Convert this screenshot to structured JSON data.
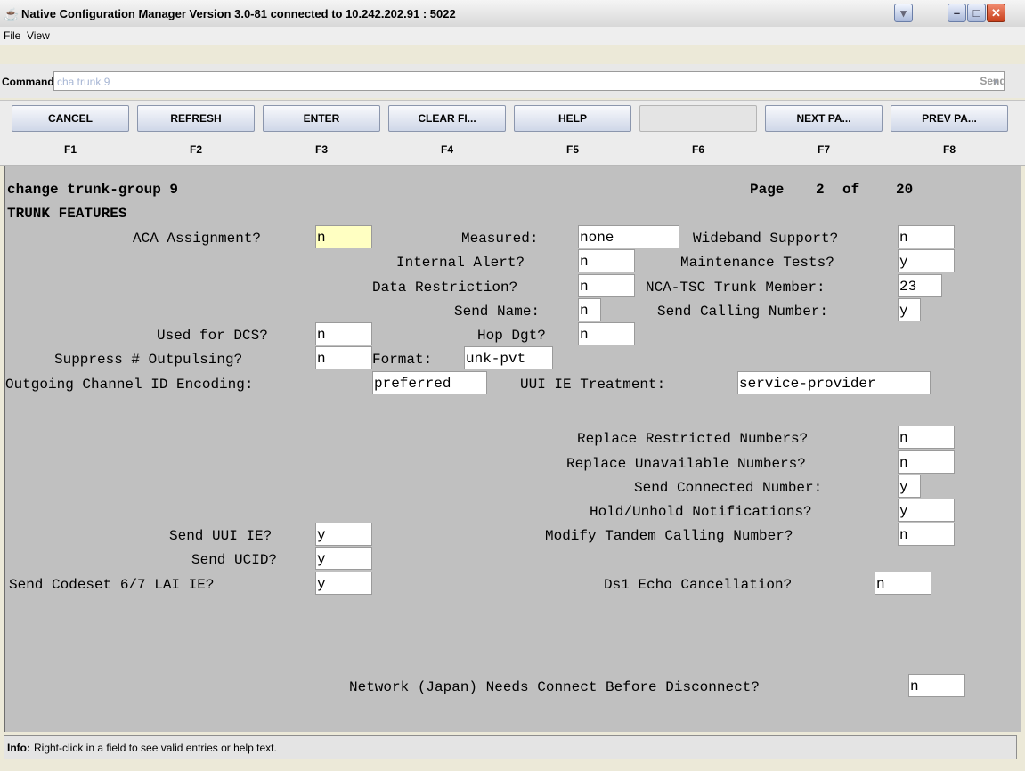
{
  "window": {
    "title": "Native Configuration Manager Version 3.0-81 connected to 10.242.202.91 : 5022",
    "controls": {
      "minimize": "–",
      "maximize": "□",
      "close": "✕",
      "dropdown": "▾"
    }
  },
  "menu": {
    "items": [
      "File",
      "View"
    ]
  },
  "command": {
    "label": "Command:",
    "value": "cha trunk 9",
    "send_label": "Send"
  },
  "function_keys": [
    {
      "label": "CANCEL",
      "key": "F1"
    },
    {
      "label": "REFRESH",
      "key": "F2"
    },
    {
      "label": "ENTER",
      "key": "F3"
    },
    {
      "label": "CLEAR FI...",
      "key": "F4"
    },
    {
      "label": "HELP",
      "key": "F5"
    },
    {
      "label": "",
      "key": "F6"
    },
    {
      "label": "NEXT PA...",
      "key": "F7"
    },
    {
      "label": "PREV PA...",
      "key": "F8"
    }
  ],
  "form": {
    "title": "change trunk-group 9",
    "page_label": "Page",
    "page_current": "2",
    "page_of": "of",
    "page_total": "20",
    "section": "TRUNK FEATURES",
    "fields": [
      {
        "label": "ACA Assignment?",
        "value": "n"
      },
      {
        "label": "Measured:",
        "value": "none"
      },
      {
        "label": "Wideband Support?",
        "value": "n"
      },
      {
        "label": "Internal Alert?",
        "value": "n"
      },
      {
        "label": "Maintenance Tests?",
        "value": "y"
      },
      {
        "label": "Data Restriction?",
        "value": "n"
      },
      {
        "label": "NCA-TSC Trunk Member:",
        "value": "23"
      },
      {
        "label": "Send Name:",
        "value": "n"
      },
      {
        "label": "Send Calling Number:",
        "value": "y"
      },
      {
        "label": "Used for DCS?",
        "value": "n"
      },
      {
        "label": "Hop Dgt?",
        "value": "n"
      },
      {
        "label": "Suppress # Outpulsing?",
        "value": "n"
      },
      {
        "label": "Format:",
        "value": "unk-pvt"
      },
      {
        "label": "Outgoing Channel ID Encoding:",
        "value": "preferred"
      },
      {
        "label": "UUI IE Treatment:",
        "value": "service-provider"
      },
      {
        "label": "Replace Restricted Numbers?",
        "value": "n"
      },
      {
        "label": "Replace Unavailable Numbers?",
        "value": "n"
      },
      {
        "label": "Send Connected Number:",
        "value": "y"
      },
      {
        "label": "Hold/Unhold Notifications?",
        "value": "y"
      },
      {
        "label": "Send UUI IE?",
        "value": "y"
      },
      {
        "label": "Modify Tandem Calling Number?",
        "value": "n"
      },
      {
        "label": "Send UCID?",
        "value": "y"
      },
      {
        "label": "Send Codeset 6/7 LAI IE?",
        "value": "y"
      },
      {
        "label": "Ds1 Echo Cancellation?",
        "value": "n"
      },
      {
        "label": "Network (Japan) Needs Connect Before Disconnect?",
        "value": "n"
      }
    ]
  },
  "info": {
    "label": "Info:",
    "text": "Right-click in a field to see valid entries or help text."
  }
}
